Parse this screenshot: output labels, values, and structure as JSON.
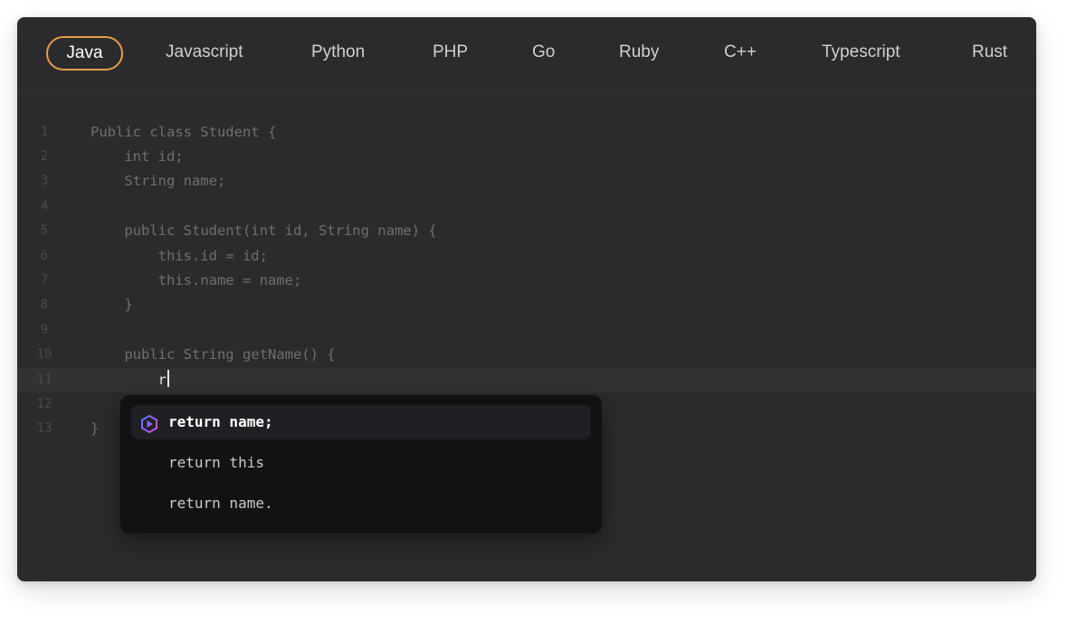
{
  "tabs": [
    {
      "label": "Java",
      "active": true
    },
    {
      "label": "Javascript",
      "active": false
    },
    {
      "label": "Python",
      "active": false
    },
    {
      "label": "PHP",
      "active": false
    },
    {
      "label": "Go",
      "active": false
    },
    {
      "label": "Ruby",
      "active": false
    },
    {
      "label": "C++",
      "active": false
    },
    {
      "label": "Typescript",
      "active": false
    },
    {
      "label": "Rust",
      "active": false
    }
  ],
  "editor": {
    "lines": [
      {
        "number": "1",
        "text": "Public class Student {"
      },
      {
        "number": "2",
        "text": "    int id;"
      },
      {
        "number": "3",
        "text": "    String name;"
      },
      {
        "number": "4",
        "text": ""
      },
      {
        "number": "5",
        "text": "    public Student(int id, String name) {"
      },
      {
        "number": "6",
        "text": "        this.id = id;"
      },
      {
        "number": "7",
        "text": "        this.name = name;"
      },
      {
        "number": "8",
        "text": "    }"
      },
      {
        "number": "9",
        "text": ""
      },
      {
        "number": "10",
        "text": "    public String getName() {"
      },
      {
        "number": "11",
        "text": "        r"
      },
      {
        "number": "12",
        "text": ""
      },
      {
        "number": "13",
        "text": "}"
      }
    ],
    "current_line": 11
  },
  "autocomplete": {
    "suggestions": [
      {
        "label": "return name;",
        "icon": "ai-assistant-icon",
        "selected": true
      },
      {
        "label": "return this",
        "selected": false
      },
      {
        "label": "return name.",
        "selected": false
      }
    ]
  },
  "colors": {
    "accent": "#e79a4a",
    "background": "#2b2b2d",
    "popup": "#121214"
  }
}
